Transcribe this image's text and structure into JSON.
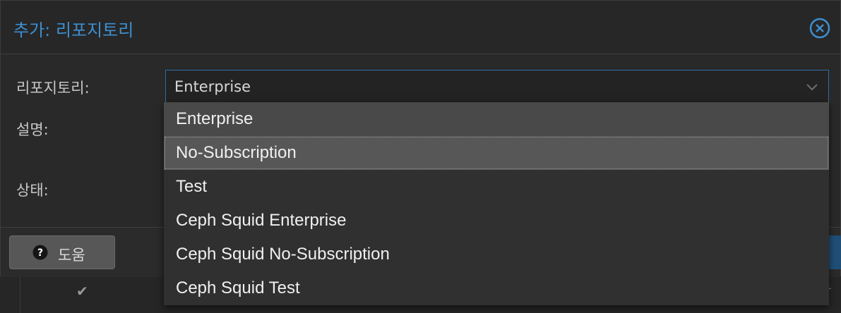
{
  "dialog": {
    "title": "추가: 리포지토리",
    "close_icon": "close-circle-icon",
    "accent_color": "#3d8fd0"
  },
  "form": {
    "repository_label": "리포지토리:",
    "description_label": "설명:",
    "status_label": "상태:",
    "repository_value": "Enterprise"
  },
  "dropdown": {
    "options": [
      "Enterprise",
      "No-Subscription",
      "Test",
      "Ceph Squid Enterprise",
      "Ceph Squid No-Subscription",
      "Ceph Squid Test"
    ],
    "selected": "Enterprise",
    "hovered": "No-Subscription"
  },
  "footer": {
    "help_label": "도움",
    "help_icon": "question-circle-icon"
  },
  "background": {
    "check_icon": "checkmark-icon",
    "right_fragment": "e-"
  }
}
